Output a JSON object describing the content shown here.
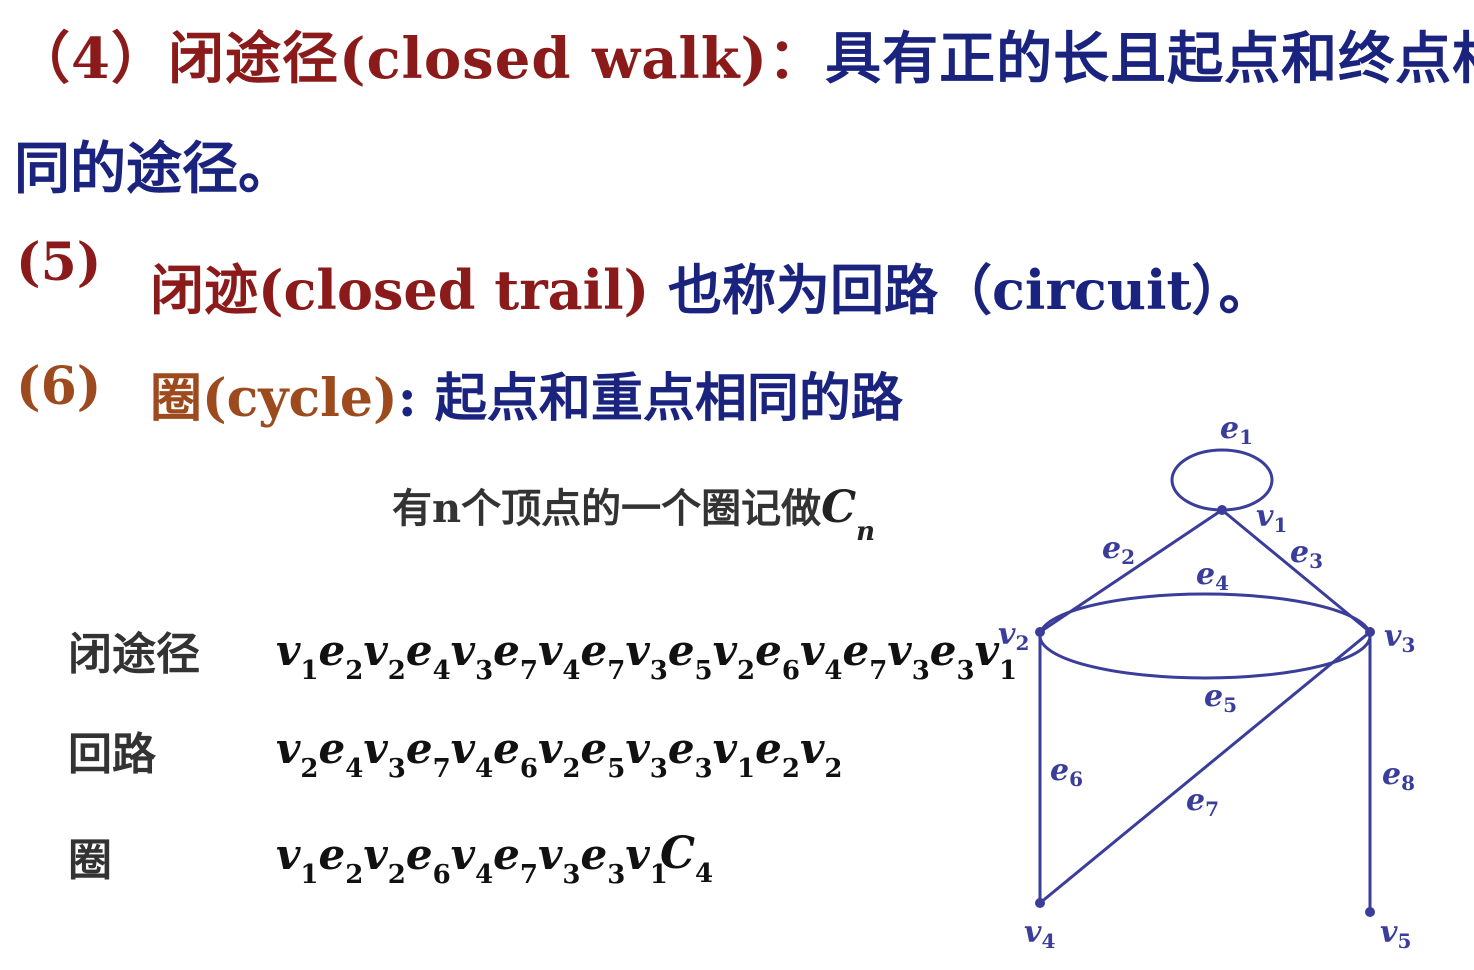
{
  "lines": {
    "l1_prefix": "（4）闭途径(closed walk)：",
    "l1_rest": "具有正的长且起点和终点相",
    "l2": "同的途径。",
    "l3_num": "(5)",
    "l3_term": "闭迹(closed trail)",
    "l3_rest": " 也称为回路（circuit）。",
    "l4_num": "(6)",
    "l4_term": "圈(cycle)",
    "l4_colon": ":",
    "l4_rest": " 起点和重点相同的路"
  },
  "cn_note": {
    "text": "有n个顶点的一个圈记做",
    "symbol": "C",
    "subscript": "n"
  },
  "examples": [
    {
      "label": "闭途径",
      "sequence": [
        [
          "v",
          "1"
        ],
        [
          "e",
          "2"
        ],
        [
          "v",
          "2"
        ],
        [
          "e",
          "4"
        ],
        [
          "v",
          "3"
        ],
        [
          "e",
          "7"
        ],
        [
          "v",
          "4"
        ],
        [
          "e",
          "7"
        ],
        [
          "v",
          "3"
        ],
        [
          "e",
          "5"
        ],
        [
          "v",
          "2"
        ],
        [
          "e",
          "6"
        ],
        [
          "v",
          "4"
        ],
        [
          "e",
          "7"
        ],
        [
          "v",
          "3"
        ],
        [
          "e",
          "3"
        ],
        [
          "v",
          "1"
        ]
      ]
    },
    {
      "label": "回路",
      "sequence": [
        [
          "v",
          "2"
        ],
        [
          "e",
          "4"
        ],
        [
          "v",
          "3"
        ],
        [
          "e",
          "7"
        ],
        [
          "v",
          "4"
        ],
        [
          "e",
          "6"
        ],
        [
          "v",
          "2"
        ],
        [
          "e",
          "5"
        ],
        [
          "v",
          "3"
        ],
        [
          "e",
          "3"
        ],
        [
          "v",
          "1"
        ],
        [
          "e",
          "2"
        ],
        [
          "v",
          "2"
        ]
      ]
    },
    {
      "label": "圈",
      "sequence": [
        [
          "v",
          "1"
        ],
        [
          "e",
          "2"
        ],
        [
          "v",
          "2"
        ],
        [
          "e",
          "6"
        ],
        [
          "v",
          "4"
        ],
        [
          "e",
          "7"
        ],
        [
          "v",
          "3"
        ],
        [
          "e",
          "3"
        ],
        [
          "v",
          "1"
        ]
      ]
    }
  ],
  "c4": {
    "symbol": "C",
    "subscript": "4"
  },
  "graph": {
    "vertices": [
      {
        "id": "v1",
        "letter": "v",
        "index": "1"
      },
      {
        "id": "v2",
        "letter": "v",
        "index": "2"
      },
      {
        "id": "v3",
        "letter": "v",
        "index": "3"
      },
      {
        "id": "v4",
        "letter": "v",
        "index": "4"
      },
      {
        "id": "v5",
        "letter": "v",
        "index": "5"
      }
    ],
    "edges": [
      {
        "id": "e1",
        "letter": "e",
        "index": "1"
      },
      {
        "id": "e2",
        "letter": "e",
        "index": "2"
      },
      {
        "id": "e3",
        "letter": "e",
        "index": "3"
      },
      {
        "id": "e4",
        "letter": "e",
        "index": "4"
      },
      {
        "id": "e5",
        "letter": "e",
        "index": "5"
      },
      {
        "id": "e6",
        "letter": "e",
        "index": "6"
      },
      {
        "id": "e7",
        "letter": "e",
        "index": "7"
      },
      {
        "id": "e8",
        "letter": "e",
        "index": "8"
      }
    ],
    "colors": {
      "stroke": "#3a3d99",
      "label": "#3a3d99"
    }
  },
  "colors": {
    "term_dark_red": "#8b1a1a",
    "term_brown": "#9c4a1e",
    "definition_navy": "#1a237e",
    "note_gray": "#333333"
  }
}
